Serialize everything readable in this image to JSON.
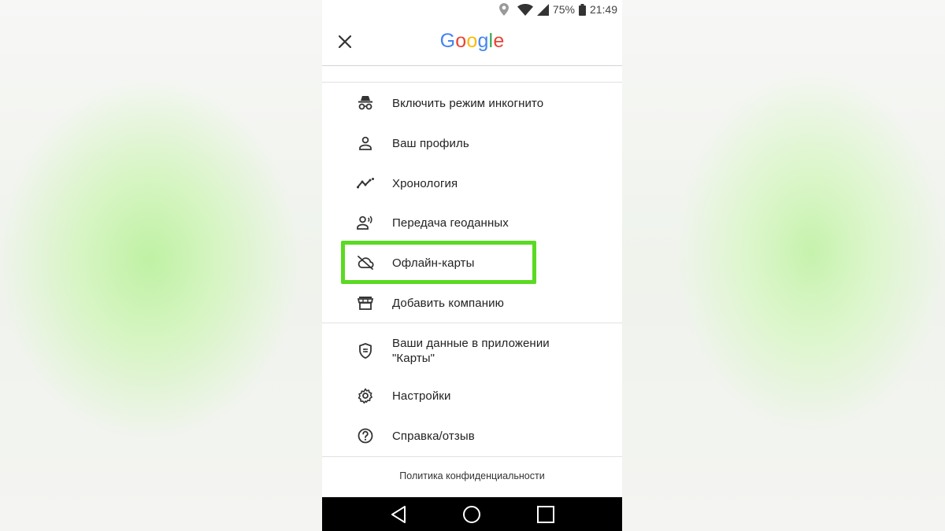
{
  "status_bar": {
    "battery": "75%",
    "time": "21:49",
    "icons": [
      "location-icon",
      "wifi-icon",
      "signal-icon",
      "battery-icon"
    ]
  },
  "header": {
    "logo_letters": [
      "G",
      "o",
      "o",
      "g",
      "l",
      "e"
    ],
    "logo_colors": [
      "#4285F4",
      "#EA4335",
      "#FBBC05",
      "#4285F4",
      "#34A853",
      "#EA4335"
    ],
    "close_icon": "close-icon"
  },
  "menu": {
    "items": [
      {
        "label": "Включить режим инкогнито",
        "icon": "incognito-icon"
      },
      {
        "label": "Ваш профиль",
        "icon": "person-icon"
      },
      {
        "label": "Хронология",
        "icon": "timeline-icon"
      },
      {
        "label": "Передача геоданных",
        "icon": "location-sharing-icon"
      },
      {
        "label": "Офлайн-карты",
        "icon": "cloud-off-icon"
      },
      {
        "label": "Добавить компанию",
        "icon": "store-icon"
      },
      {
        "label": "Ваши данные в приложении",
        "label_line2": "\"Карты\"",
        "icon": "shield-icon"
      },
      {
        "label": "Настройки",
        "icon": "gear-icon"
      },
      {
        "label": "Справка/отзыв",
        "icon": "help-icon"
      }
    ],
    "highlighted_item": "Офлайн-карты",
    "highlight_color": "#5ada22"
  },
  "footer": {
    "privacy_link": "Политика конфиденциальности"
  },
  "nav_bar": {
    "buttons": [
      "back-icon",
      "home-icon",
      "recents-icon"
    ]
  }
}
